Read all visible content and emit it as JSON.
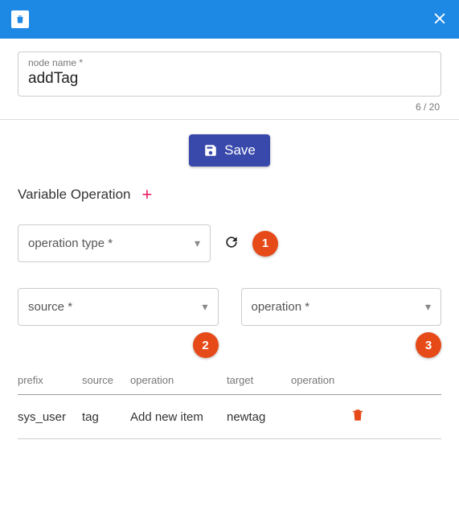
{
  "header": {
    "brand_icon": "delete-in-box"
  },
  "node_name": {
    "label": "node name *",
    "value": "addTag",
    "counter": "6 / 20"
  },
  "save_label": "Save",
  "section_title": "Variable Operation",
  "selects": {
    "operation_type": "operation type *",
    "source": "source *",
    "operation": "operation *"
  },
  "badges": {
    "one": "1",
    "two": "2",
    "three": "3"
  },
  "table": {
    "headers": {
      "prefix": "prefix",
      "source": "source",
      "operation1": "operation",
      "target": "target",
      "operation2": "operation"
    },
    "rows": [
      {
        "prefix": "sys_user",
        "source": "tag",
        "operation1": "Add new item",
        "target": "newtag",
        "operation2": ""
      }
    ]
  }
}
